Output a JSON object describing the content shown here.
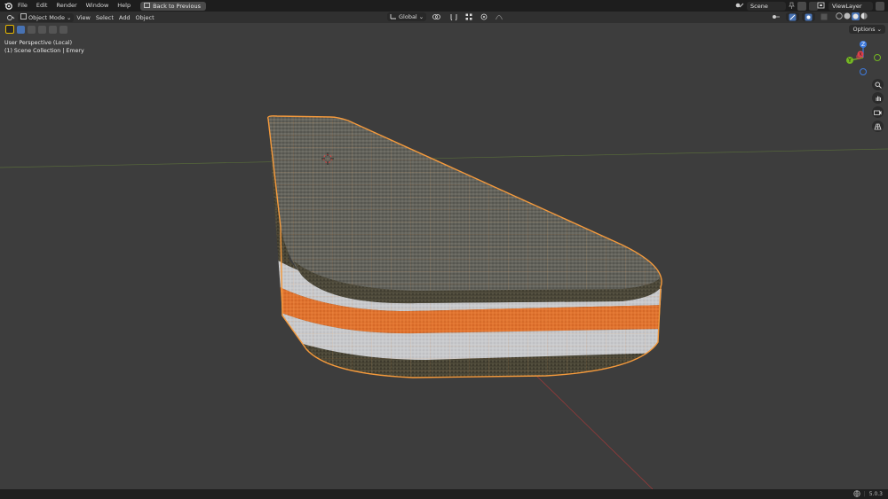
{
  "menu": {
    "file": "File",
    "edit": "Edit",
    "render": "Render",
    "window": "Window",
    "help": "Help",
    "back_to_previous": "Back to Previous"
  },
  "scene": {
    "name": "Scene",
    "view_layer": "ViewLayer"
  },
  "header": {
    "mode": "Object Mode",
    "view": "View",
    "select": "Select",
    "add": "Add",
    "object": "Object",
    "transform_orientation": "Global",
    "options": "Options"
  },
  "viewport": {
    "perspective_label": "User Perspective (Local)",
    "collection_label": "(1) Scene Collection | Emery"
  },
  "gizmo": {
    "z": "Z",
    "y": "Y",
    "x": "X"
  },
  "status": {
    "version": "5.0.3"
  },
  "colors": {
    "accent": "#4772b3",
    "selection_outline": "#f59a3c",
    "axis_x": "#e0414c",
    "axis_y": "#74b623",
    "axis_z": "#3f7bde"
  },
  "icons": [
    "blender-logo-icon",
    "back-icon",
    "scene-icon",
    "pin-icon",
    "view-layer-icon",
    "zoom-icon",
    "hand-icon",
    "camera-icon",
    "grid-icon",
    "globe-icon"
  ]
}
